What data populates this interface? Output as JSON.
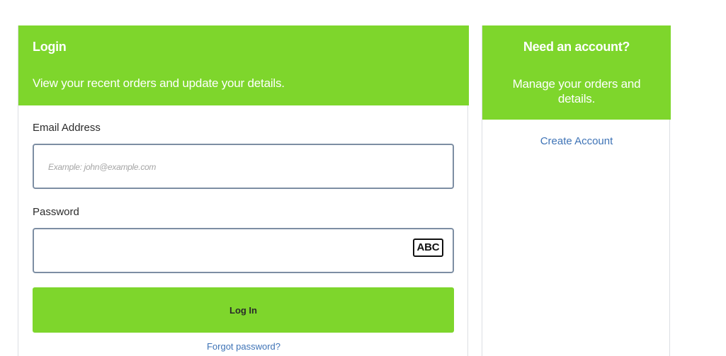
{
  "login": {
    "title": "Login",
    "subtitle": "View your recent orders and update your details.",
    "email_label": "Email Address",
    "email_placeholder": "Example: john@example.com",
    "email_value": "",
    "password_label": "Password",
    "password_value": "",
    "password_badge": "ABC",
    "submit_label": "Log In",
    "forgot_label": "Forgot password?"
  },
  "account": {
    "title": "Need an account?",
    "subtitle": "Manage your orders and details.",
    "create_label": "Create Account"
  },
  "colors": {
    "brand_green": "#7ed62c",
    "link_blue": "#3e73b6",
    "input_border": "#7d8ea3"
  }
}
